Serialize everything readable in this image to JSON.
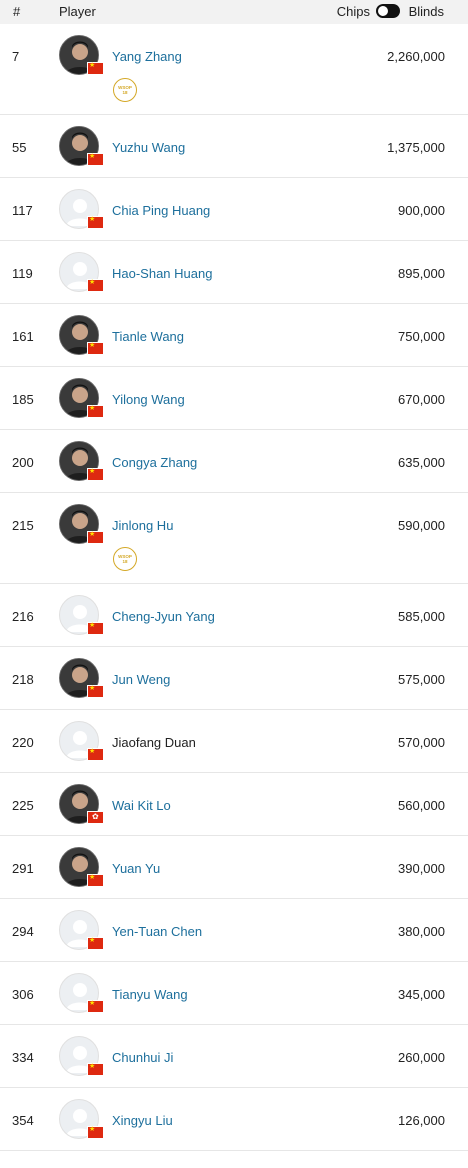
{
  "header": {
    "rank_label": "#",
    "player_label": "Player",
    "chips_label": "Chips",
    "blinds_label": "Blinds",
    "toggle_mode": "chips"
  },
  "badge": {
    "line1": "WSOP",
    "line2": "18"
  },
  "players": [
    {
      "rank": "7",
      "name": "Yang Zhang",
      "chips": "2,260,000",
      "photo": true,
      "flag": "cn",
      "badge": true,
      "linked": true
    },
    {
      "rank": "55",
      "name": "Yuzhu Wang",
      "chips": "1,375,000",
      "photo": true,
      "flag": "cn",
      "badge": false,
      "linked": true
    },
    {
      "rank": "117",
      "name": "Chia Ping Huang",
      "chips": "900,000",
      "photo": false,
      "flag": "cn",
      "badge": false,
      "linked": true
    },
    {
      "rank": "119",
      "name": "Hao-Shan Huang",
      "chips": "895,000",
      "photo": false,
      "flag": "cn",
      "badge": false,
      "linked": true
    },
    {
      "rank": "161",
      "name": "Tianle Wang",
      "chips": "750,000",
      "photo": true,
      "flag": "cn",
      "badge": false,
      "linked": true
    },
    {
      "rank": "185",
      "name": "Yilong Wang",
      "chips": "670,000",
      "photo": true,
      "flag": "cn",
      "badge": false,
      "linked": true
    },
    {
      "rank": "200",
      "name": "Congya Zhang",
      "chips": "635,000",
      "photo": true,
      "flag": "cn",
      "badge": false,
      "linked": true
    },
    {
      "rank": "215",
      "name": "Jinlong Hu",
      "chips": "590,000",
      "photo": true,
      "flag": "cn",
      "badge": true,
      "linked": true
    },
    {
      "rank": "216",
      "name": "Cheng-Jyun Yang",
      "chips": "585,000",
      "photo": false,
      "flag": "cn",
      "badge": false,
      "linked": true
    },
    {
      "rank": "218",
      "name": "Jun Weng",
      "chips": "575,000",
      "photo": true,
      "flag": "cn",
      "badge": false,
      "linked": true
    },
    {
      "rank": "220",
      "name": "Jiaofang Duan",
      "chips": "570,000",
      "photo": false,
      "flag": "cn",
      "badge": false,
      "linked": false
    },
    {
      "rank": "225",
      "name": "Wai Kit Lo",
      "chips": "560,000",
      "photo": true,
      "flag": "hk",
      "badge": false,
      "linked": true
    },
    {
      "rank": "291",
      "name": "Yuan Yu",
      "chips": "390,000",
      "photo": true,
      "flag": "cn",
      "badge": false,
      "linked": true
    },
    {
      "rank": "294",
      "name": "Yen-Tuan Chen",
      "chips": "380,000",
      "photo": false,
      "flag": "cn",
      "badge": false,
      "linked": true
    },
    {
      "rank": "306",
      "name": "Tianyu Wang",
      "chips": "345,000",
      "photo": false,
      "flag": "cn",
      "badge": false,
      "linked": true
    },
    {
      "rank": "334",
      "name": "Chunhui Ji",
      "chips": "260,000",
      "photo": false,
      "flag": "cn",
      "badge": false,
      "linked": true
    },
    {
      "rank": "354",
      "name": "Xingyu Liu",
      "chips": "126,000",
      "photo": false,
      "flag": "cn",
      "badge": false,
      "linked": true
    }
  ]
}
